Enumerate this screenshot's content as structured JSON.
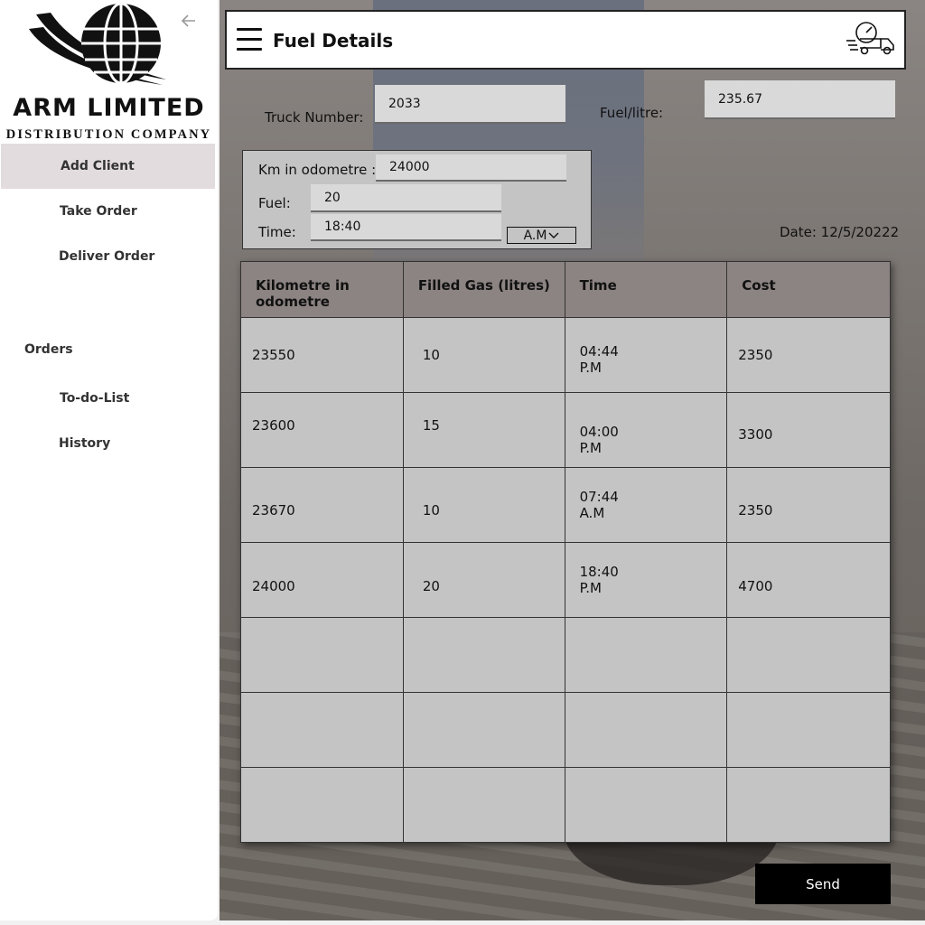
{
  "brand": {
    "name": "ARM LIMITED",
    "subtitle": "DISTRIBUTION COMPANY",
    "logo_icon": "globe-logo-icon"
  },
  "sidebar": {
    "back_icon": "arrow-left-icon",
    "items": [
      {
        "label": "Add Client",
        "active": true
      },
      {
        "label": "Take Order",
        "active": false
      },
      {
        "label": "Deliver Order",
        "active": false
      }
    ],
    "section_label": "Orders",
    "section_items": [
      {
        "label": "To-do-List"
      },
      {
        "label": "History"
      }
    ]
  },
  "header": {
    "title": "Fuel Details",
    "menu_icon": "hamburger-menu-icon",
    "truck_icon": "fuel-truck-gauge-icon"
  },
  "form": {
    "truck_number_label": "Truck Number:",
    "truck_number_value": "2033",
    "fuel_per_litre_label": "Fuel/litre:",
    "fuel_per_litre_value": "235.67",
    "km_label": "Km in odometre :",
    "km_value": "24000",
    "fuel_label": "Fuel:",
    "fuel_value": "20",
    "time_label": "Time:",
    "time_value": "18:40",
    "ampm_value": "A.M",
    "date_text": "Date: 12/5/20222"
  },
  "table": {
    "headers": [
      "Kilometre in odometre",
      "Filled Gas (litres)",
      "Time",
      "Cost"
    ],
    "rows": [
      [
        "23550",
        "10",
        "04:44\nP.M",
        "2350"
      ],
      [
        "23600",
        "15",
        "04:00\nP.M",
        "3300"
      ],
      [
        "23670",
        "10",
        "07:44\nA.M",
        "2350"
      ],
      [
        "24000",
        "20",
        "18:40\nP.M",
        "4700"
      ],
      [
        "",
        "",
        "",
        ""
      ],
      [
        "",
        "",
        "",
        ""
      ],
      [
        "",
        "",
        "",
        ""
      ]
    ]
  },
  "actions": {
    "send_label": "Send"
  },
  "colors": {
    "header_row": "#8c8482",
    "cell": "#c4c4c4",
    "active_nav": "#e3dcdf",
    "button": "#000000"
  }
}
